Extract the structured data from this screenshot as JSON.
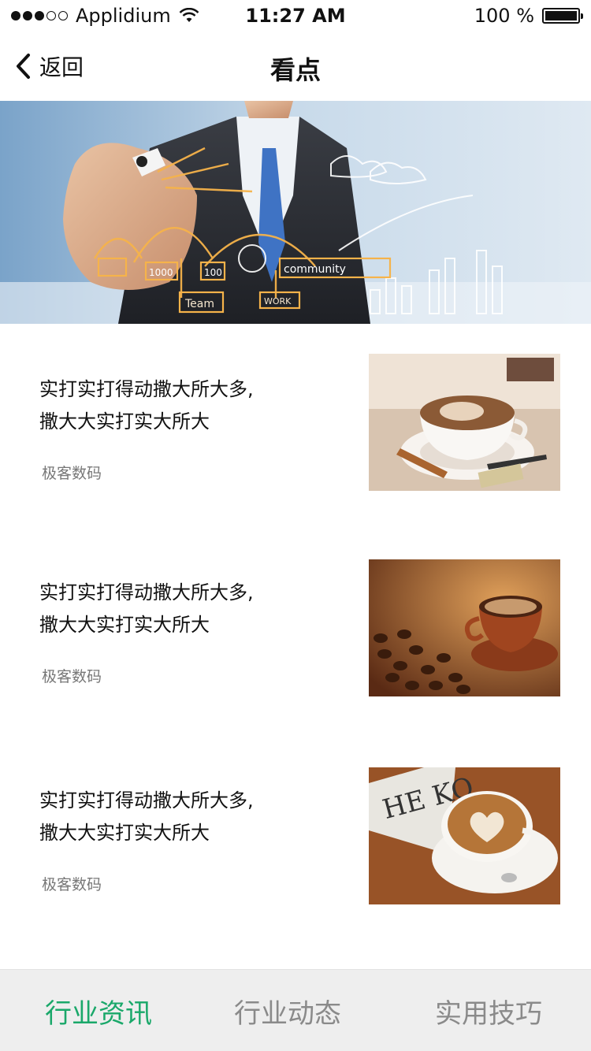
{
  "status_bar": {
    "carrier": "Applidium",
    "time": "11:27 AM",
    "battery_text": "100 %"
  },
  "nav": {
    "back_label": "返回",
    "title": "看点"
  },
  "banner": {
    "labels": [
      "Team",
      "WORK",
      "community",
      "100",
      "1000"
    ]
  },
  "news_items": [
    {
      "title_line1": "实打实打得动撒大所大多,",
      "title_line2": "撒大大实打实大所大",
      "source": "极客数码"
    },
    {
      "title_line1": "实打实打得动撒大所大多,",
      "title_line2": "撒大大实打实大所大",
      "source": "极客数码"
    },
    {
      "title_line1": "实打实打得动撒大所大多,",
      "title_line2": "撒大大实打实大所大",
      "source": "极客数码"
    }
  ],
  "tabs": [
    {
      "label": "行业资讯",
      "active": true
    },
    {
      "label": "行业动态",
      "active": false
    },
    {
      "label": "实用技巧",
      "active": false
    }
  ],
  "colors": {
    "active_tab": "#1aa86a",
    "inactive_tab": "#8a8a8a",
    "tab_bar_bg": "#eeeeee"
  }
}
